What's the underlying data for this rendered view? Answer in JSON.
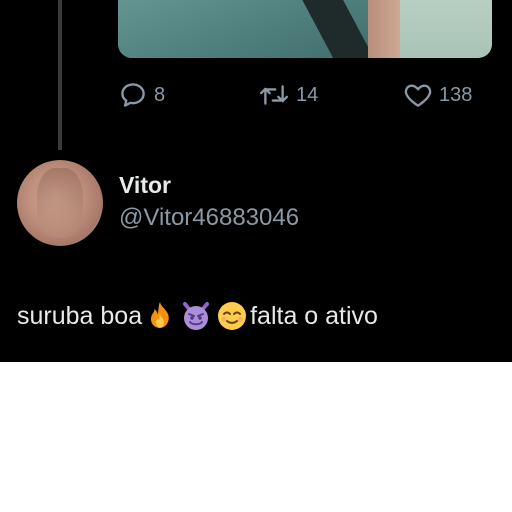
{
  "actions": {
    "reply_count": "8",
    "retweet_count": "14",
    "like_count": "138"
  },
  "tweet": {
    "author_name": "Vitor",
    "author_handle": "@Vitor46883046",
    "text_start": "suruba boa",
    "text_end": "falta o ativo",
    "emojis": [
      "fire-emoji",
      "smiling-devil-emoji",
      "relieved-face-emoji"
    ]
  },
  "colors": {
    "background": "#000000",
    "primary_text": "#e7e9ea",
    "secondary_text": "#8b98a5",
    "thread_line": "#3a3a3a"
  }
}
